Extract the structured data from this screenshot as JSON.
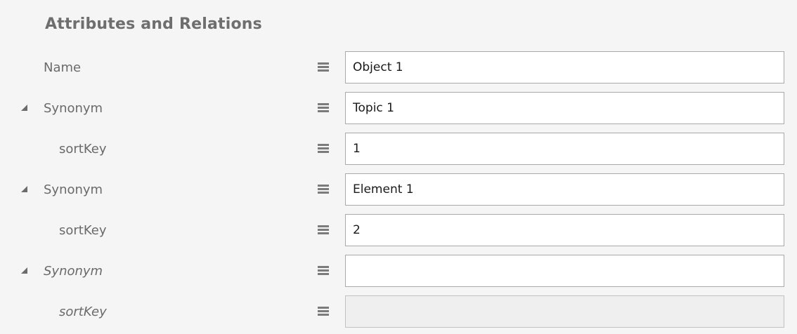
{
  "section": {
    "title": "Attributes and Relations"
  },
  "rows": [
    {
      "label": "Name",
      "value": "Object 1",
      "has_expander": false,
      "indent": false,
      "italic": false,
      "disabled": false
    },
    {
      "label": "Synonym",
      "value": "Topic 1",
      "has_expander": true,
      "indent": false,
      "italic": false,
      "disabled": false
    },
    {
      "label": "sortKey",
      "value": "1",
      "has_expander": false,
      "indent": true,
      "italic": false,
      "disabled": false
    },
    {
      "label": "Synonym",
      "value": "Element 1",
      "has_expander": true,
      "indent": false,
      "italic": false,
      "disabled": false
    },
    {
      "label": "sortKey",
      "value": "2",
      "has_expander": false,
      "indent": true,
      "italic": false,
      "disabled": false
    },
    {
      "label": "Synonym",
      "value": "",
      "has_expander": true,
      "indent": false,
      "italic": true,
      "disabled": false
    },
    {
      "label": "sortKey",
      "value": "",
      "has_expander": false,
      "indent": true,
      "italic": true,
      "disabled": true
    }
  ],
  "icons": {
    "expander": "triangle-expanded-icon",
    "row_menu": "hamburger-menu-icon"
  }
}
